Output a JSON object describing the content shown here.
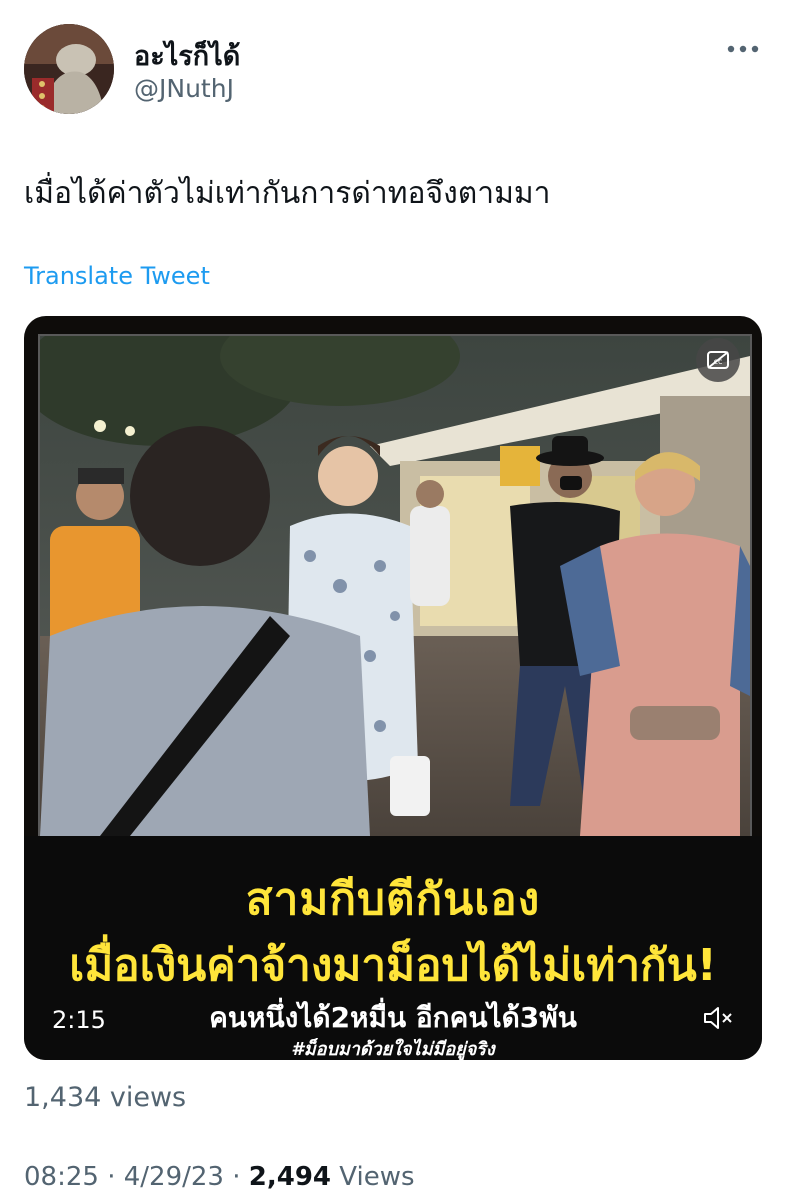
{
  "author": {
    "display_name": "อะไรก็ได้",
    "handle": "@JNuthJ"
  },
  "tweet": {
    "text": "เมื่อได้ค่าตัวไม่เท่ากันการด่าทอจึงตามมา",
    "translate_label": "Translate Tweet"
  },
  "video": {
    "caption_line1": "สามกีบตีกันเอง",
    "caption_line2": "เมื่อเงินค่าจ้างมาม็อบได้ไม่เท่ากัน!",
    "caption_line3": "คนหนึ่งได้2หมื่น อีกคนได้3พัน",
    "caption_hashtag": "#ม็อบมาด้วยใจไม่มีอยู่จริง",
    "duration": "2:15",
    "icons": [
      "closed-captions-icon",
      "speaker-muted-icon"
    ]
  },
  "stats": {
    "views_count": "1,434 views",
    "time": "08:25",
    "sep1": "·",
    "date": "4/29/23",
    "sep2": "·",
    "views_total": "2,494",
    "views_label": "Views"
  },
  "colors": {
    "link": "#1d9bf0",
    "caption_yellow": "#ffe53a",
    "secondary_text": "#536471"
  }
}
